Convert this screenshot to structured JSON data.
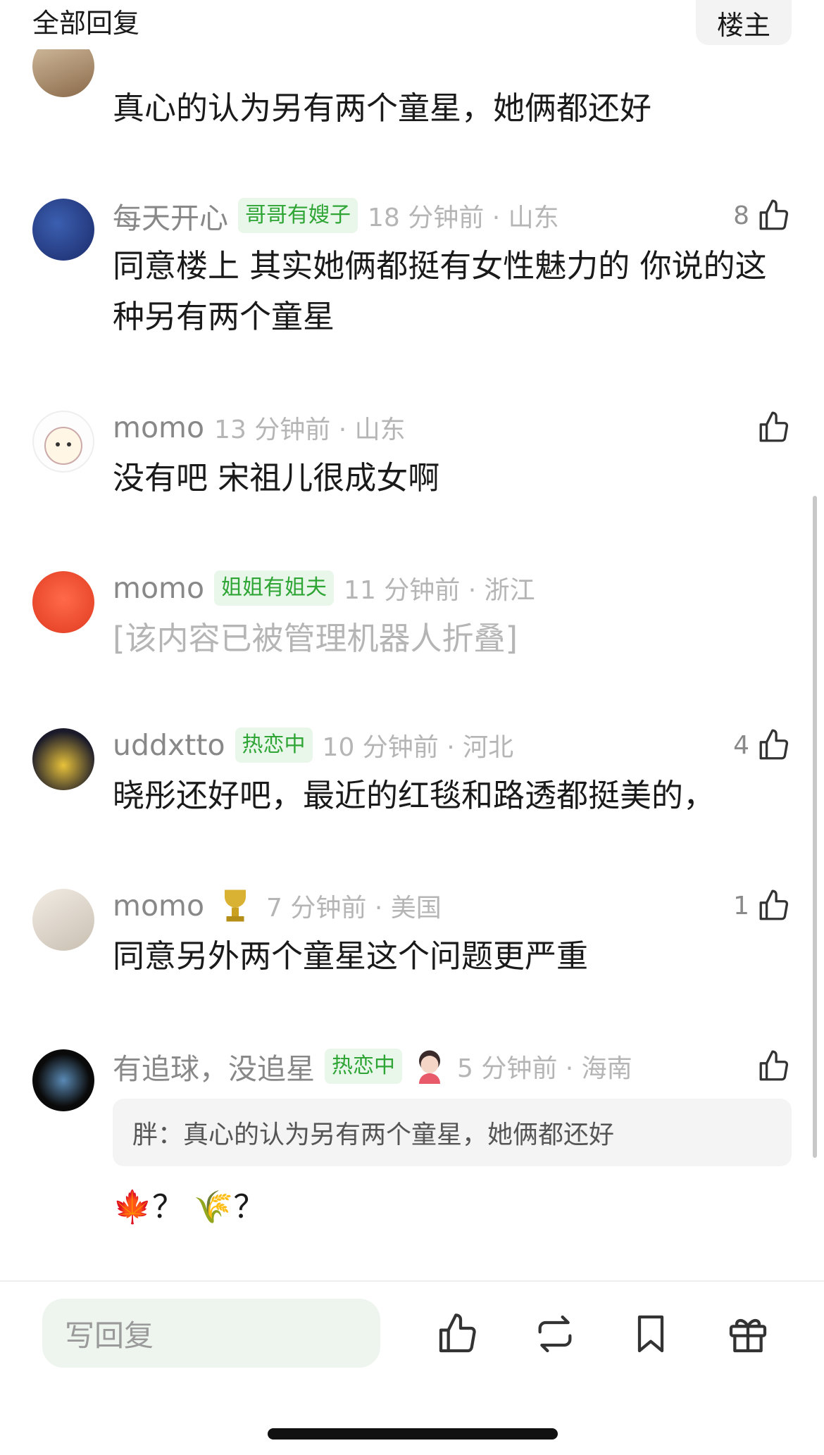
{
  "header": {
    "title": "全部回复",
    "owner_label": "楼主"
  },
  "comments": [
    {
      "body": "真心的认为另有两个童星，她俩都还好"
    },
    {
      "username": "每天开心",
      "badge": "哥哥有嫂子",
      "time": "18 分钟前 · 山东",
      "likes": "8",
      "body": "同意楼上 其实她俩都挺有女性魅力的 你说的这种另有两个童星"
    },
    {
      "username": "momo",
      "time": "13 分钟前 · 山东",
      "likes": "",
      "body": "没有吧 宋祖儿很成女啊"
    },
    {
      "username": "momo",
      "badge": "姐姐有姐夫",
      "time": "11 分钟前 · 浙江",
      "likes": "",
      "body": "[该内容已被管理机器人折叠]"
    },
    {
      "username": "uddxtto",
      "badge": "热恋中",
      "time": "10 分钟前 · 河北",
      "likes": "4",
      "body": "晓彤还好吧，最近的红毯和路透都挺美的，"
    },
    {
      "username": "momo",
      "time": "7 分钟前 · 美国",
      "likes": "1",
      "body": "同意另外两个童星这个问题更严重"
    },
    {
      "username": "有追球，没追星",
      "badge": "热恋中",
      "time": "5 分钟前 · 海南",
      "likes": "",
      "quote": "胖：真心的认为另有两个童星，她俩都还好",
      "body": "🍁？ 🌾？"
    }
  ],
  "bottom_bar": {
    "reply_placeholder": "写回复"
  },
  "colors": {
    "badge_green": "#2fa536",
    "badge_bg": "#e8f7e9",
    "meta_gray": "#b5b5b5"
  }
}
